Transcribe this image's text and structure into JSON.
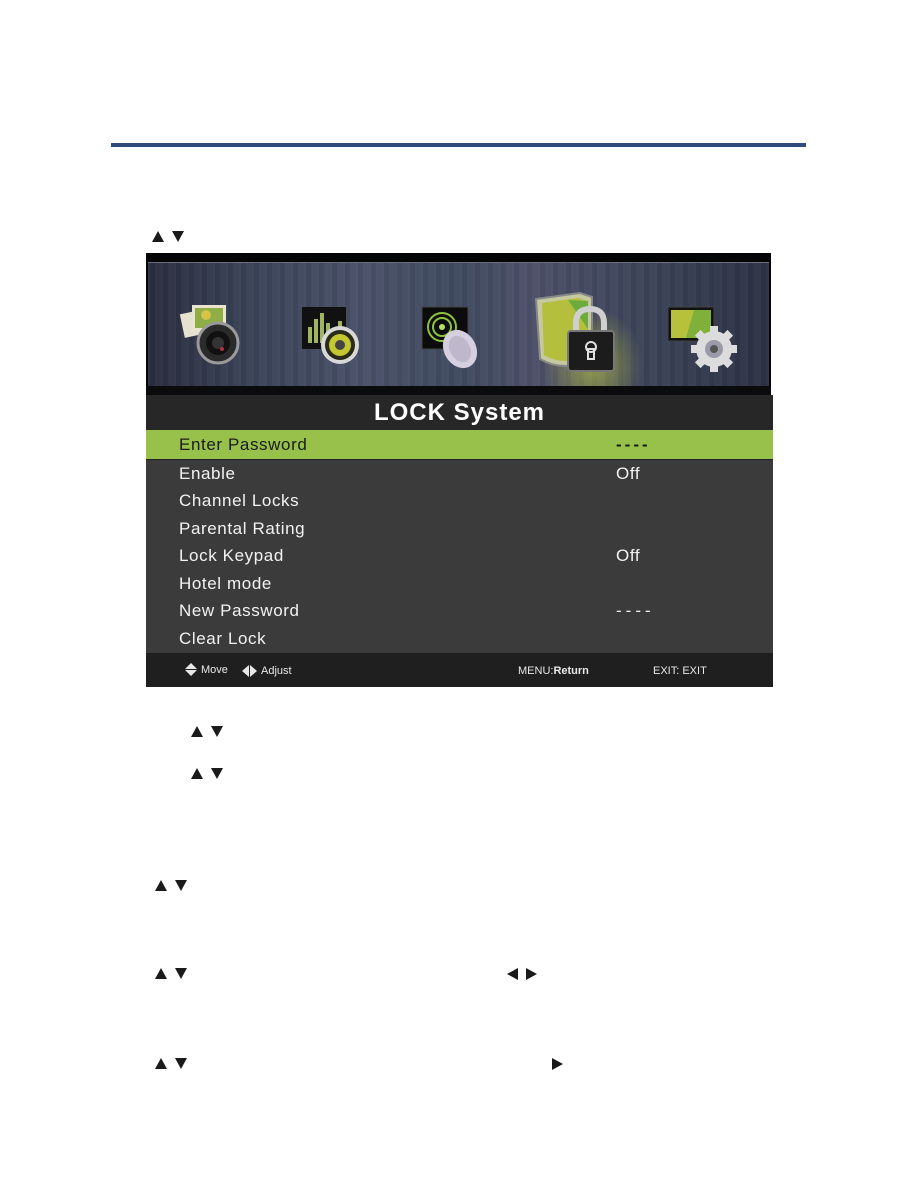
{
  "page": {
    "accent_rule_color": "#2f4b7a"
  },
  "tv_menu": {
    "icons": [
      {
        "name": "picture",
        "icon": "photo-camera-icon"
      },
      {
        "name": "sound",
        "icon": "speaker-equalizer-icon"
      },
      {
        "name": "channel",
        "icon": "satellite-dish-icon"
      },
      {
        "name": "lock",
        "icon": "shield-padlock-icon",
        "active": true
      },
      {
        "name": "setup",
        "icon": "monitor-gear-icon"
      }
    ],
    "title": "LOCK System",
    "highlight_color": "#97c14a",
    "items": [
      {
        "label": "Enter Password",
        "value": "----",
        "selected": true
      },
      {
        "label": "Enable",
        "value": "Off"
      },
      {
        "label": "Channel Locks",
        "value": ""
      },
      {
        "label": "Parental Rating",
        "value": ""
      },
      {
        "label": "Lock Keypad",
        "value": "Off"
      },
      {
        "label": "Hotel mode",
        "value": ""
      },
      {
        "label": "New Password",
        "value": "----"
      },
      {
        "label": "Clear Lock",
        "value": ""
      }
    ],
    "footer": {
      "move_label": "Move",
      "adjust_label": "Adjust",
      "menu_key": "MENU:",
      "menu_action": "Return",
      "exit_label": "EXIT: EXIT"
    }
  },
  "instructions": {
    "arrow_rows": [
      {
        "glyphs": [
          "up",
          "down"
        ]
      },
      {
        "glyphs": [
          "up",
          "down"
        ]
      },
      {
        "glyphs": [
          "up",
          "down"
        ]
      },
      {
        "glyphs": [
          "up",
          "down"
        ]
      },
      {
        "glyphs": [
          "up",
          "down",
          "left",
          "right"
        ]
      },
      {
        "glyphs": [
          "up",
          "down",
          "right"
        ]
      }
    ]
  }
}
